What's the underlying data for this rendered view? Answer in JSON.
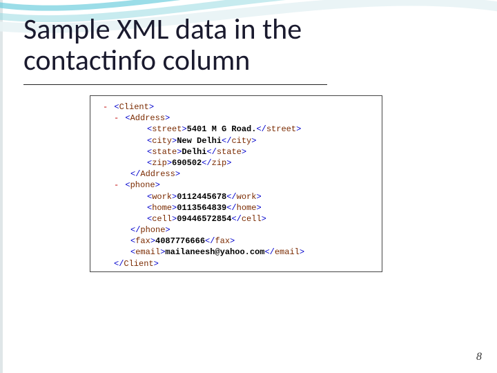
{
  "title_line1": "Sample XML data in the",
  "title_line2": "contactinfo column",
  "page_number": "8",
  "xml": {
    "root": "Client",
    "elems": [
      {
        "type": "group",
        "tag": "Address",
        "children": [
          {
            "tag": "street",
            "value": "5401 M G Road."
          },
          {
            "tag": "city",
            "value": "New Delhi"
          },
          {
            "tag": "state",
            "value": "Delhi"
          },
          {
            "tag": "zip",
            "value": "690502"
          }
        ]
      },
      {
        "type": "group",
        "tag": "phone",
        "children": [
          {
            "tag": "work",
            "value": "0112445678"
          },
          {
            "tag": "home",
            "value": "0113564839"
          },
          {
            "tag": "cell",
            "value": "09446572854"
          }
        ]
      },
      {
        "type": "leaf",
        "tag": "fax",
        "value": "4087776666"
      },
      {
        "type": "leaf",
        "tag": "email",
        "value": "mailaneesh@yahoo.com"
      }
    ]
  }
}
